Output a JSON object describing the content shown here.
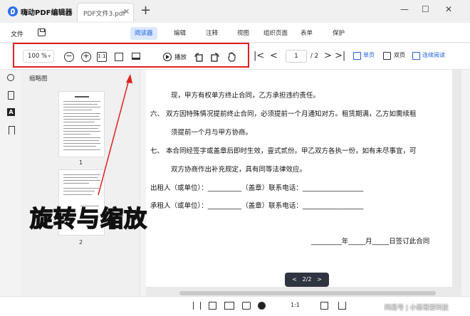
{
  "app": {
    "name": "嗨动PDF编辑器",
    "tab_title": "PDF文件3.pdf",
    "tab_close": "✕",
    "new_tab": "+"
  },
  "window_controls": {
    "minimize": "—",
    "maximize": "☐",
    "close": "✕"
  },
  "menubar": {
    "file": "文件",
    "tabs": [
      "阅读器",
      "编辑",
      "注释",
      "视图",
      "组织页面",
      "表单",
      "保护"
    ],
    "active_tab": "阅读器"
  },
  "toolbar": {
    "zoom": "100",
    "zoom_unit": "%",
    "zoom_out_icon": "−",
    "zoom_in_icon": "+",
    "actual_size": "1:1",
    "play_label": "播放",
    "page_current": "1",
    "page_total": "/ 2",
    "first_icon": "|<",
    "prev_icon": "<",
    "next_icon": ">",
    "last_icon": ">|",
    "view_single": "单页",
    "view_double": "双页",
    "view_continuous": "连续阅读"
  },
  "sidebar": {
    "thumb_title": "缩略图",
    "pages": [
      "1",
      "2"
    ]
  },
  "document": {
    "lines": [
      "现，甲方有权单方终止合同，乙方承担违约责任。",
      "六、    双方因特殊情况提前终止合同，必须提前一个月通知对方。租赁期满，乙方如需续租",
      "须提前一个月与甲方协商。",
      "七、    本合同经签字或盖章后即时生效，壹式贰份。甲乙双方各执一份，如有未尽事宜，可",
      "双方协商作出补充规定，具有同等法律效应。",
      "出租人（或单位）：__________（盖章）联系电话：__________________",
      "承租人（或单位）：__________（盖章）联系电话：__________________",
      "_________年_____月_____日签订此合同"
    ],
    "page_indicator": "2/2",
    "pill_prev": "<",
    "pill_next": ">"
  },
  "overlay_caption": "旋转与缩放",
  "watermark": "网易号 | 小思哥爱科技",
  "colors": {
    "accent": "#1d5fe0",
    "highlight": "#e02020",
    "caption": "#f4d000"
  }
}
